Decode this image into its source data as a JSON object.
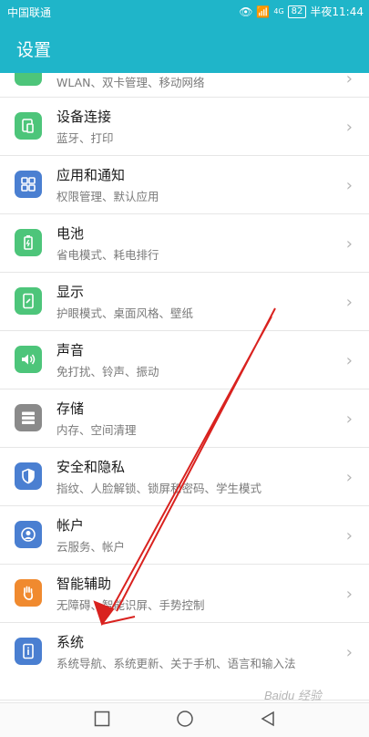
{
  "status": {
    "carrier": "中国联通",
    "battery": "82",
    "time": "半夜11:44",
    "signal": "4G"
  },
  "header": {
    "title": "设置"
  },
  "items": [
    {
      "title": "",
      "sub": "WLAN、双卡管理、移动网络",
      "icon": "network-icon",
      "color": "#4dc57a"
    },
    {
      "title": "设备连接",
      "sub": "蓝牙、打印",
      "icon": "device-connect-icon",
      "color": "#4dc57a"
    },
    {
      "title": "应用和通知",
      "sub": "权限管理、默认应用",
      "icon": "apps-icon",
      "color": "#4a7fd1"
    },
    {
      "title": "电池",
      "sub": "省电模式、耗电排行",
      "icon": "battery-icon",
      "color": "#4dc57a"
    },
    {
      "title": "显示",
      "sub": "护眼模式、桌面风格、壁纸",
      "icon": "display-icon",
      "color": "#4dc57a"
    },
    {
      "title": "声音",
      "sub": "免打扰、铃声、振动",
      "icon": "sound-icon",
      "color": "#4dc57a"
    },
    {
      "title": "存储",
      "sub": "内存、空间清理",
      "icon": "storage-icon",
      "color": "#8a8a8a"
    },
    {
      "title": "安全和隐私",
      "sub": "指纹、人脸解锁、锁屏和密码、学生模式",
      "icon": "shield-icon",
      "color": "#4a7fd1"
    },
    {
      "title": "帐户",
      "sub": "云服务、帐户",
      "icon": "account-icon",
      "color": "#4a7fd1"
    },
    {
      "title": "智能辅助",
      "sub": "无障碍、智能识屏、手势控制",
      "icon": "hand-icon",
      "color": "#f08a2f"
    },
    {
      "title": "系统",
      "sub": "系统导航、系统更新、关于手机、语言和输入法",
      "icon": "system-info-icon",
      "color": "#4a7fd1"
    }
  ],
  "watermark": "Baidu 经验"
}
